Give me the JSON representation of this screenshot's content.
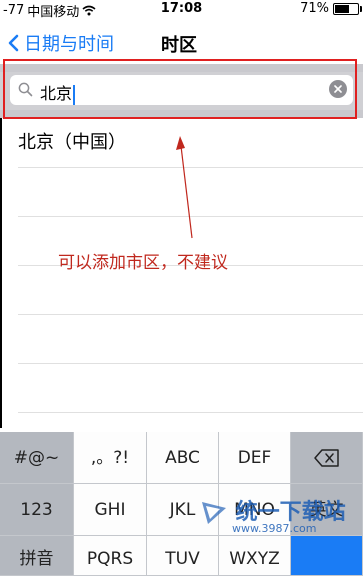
{
  "status": {
    "signal": "-77",
    "carrier": "中国移动",
    "time": "17:08",
    "battery": "71%",
    "battery_level": 0.71
  },
  "nav": {
    "back_label": "日期与时间",
    "title": "时区"
  },
  "search": {
    "value": "北京"
  },
  "results": [
    {
      "label": "北京（中国）"
    }
  ],
  "annotation": "可以添加市区，不建议",
  "keyboard": {
    "row1": [
      "#@~",
      ",。?!",
      "ABC",
      "DEF"
    ],
    "row2": [
      "123",
      "GHI",
      "JKL",
      "MNO",
      "英文"
    ],
    "row3": [
      "拼音",
      "PQRS",
      "TUV",
      "WXYZ"
    ]
  },
  "watermark": {
    "text": "统一下载站",
    "url": "www.3987.com"
  },
  "colors": {
    "accent": "#1a7cf5",
    "annotation": "#c0281e",
    "highlight_box": "#e02020"
  }
}
